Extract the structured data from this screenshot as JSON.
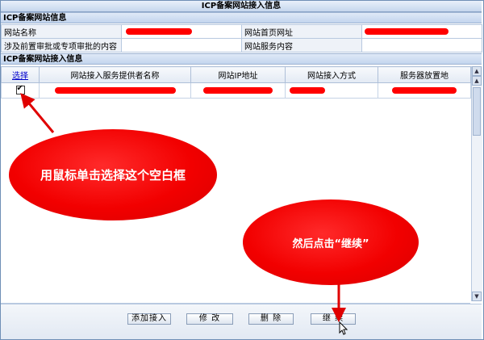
{
  "window": {
    "title": "ICP备案网站接入信息"
  },
  "site_info": {
    "header": "ICP备案网站信息",
    "site_name_label": "网站名称",
    "homepage_url_label": "网站首页网址",
    "pre_approval_label": "涉及前置审批或专项审批的内容",
    "service_content_label": "网站服务内容",
    "pre_approval_value": "",
    "service_content_value": ""
  },
  "access_info": {
    "header": "ICP备案网站接入信息",
    "columns": [
      "选择",
      "网站接入服务提供者名称",
      "网站IP地址",
      "网站接入方式",
      "服务器放置地"
    ],
    "rows": [
      {
        "selected": true,
        "check_glyph": "✔"
      }
    ]
  },
  "buttons": {
    "add": "添加接入",
    "modify": "修 改",
    "delete": "删 除",
    "continue": "继 续"
  },
  "annotations": {
    "select_hint": "用鼠标单击选择这个空白框",
    "continue_hint": "然后点击“继续”"
  },
  "scrollbar": {
    "up_glyph": "▲",
    "down_glyph": "▼"
  },
  "colors": {
    "redaction": "#ff0000",
    "header_bg": "#c6d7ee",
    "border": "#b8c9e0",
    "link": "#0000cc"
  }
}
